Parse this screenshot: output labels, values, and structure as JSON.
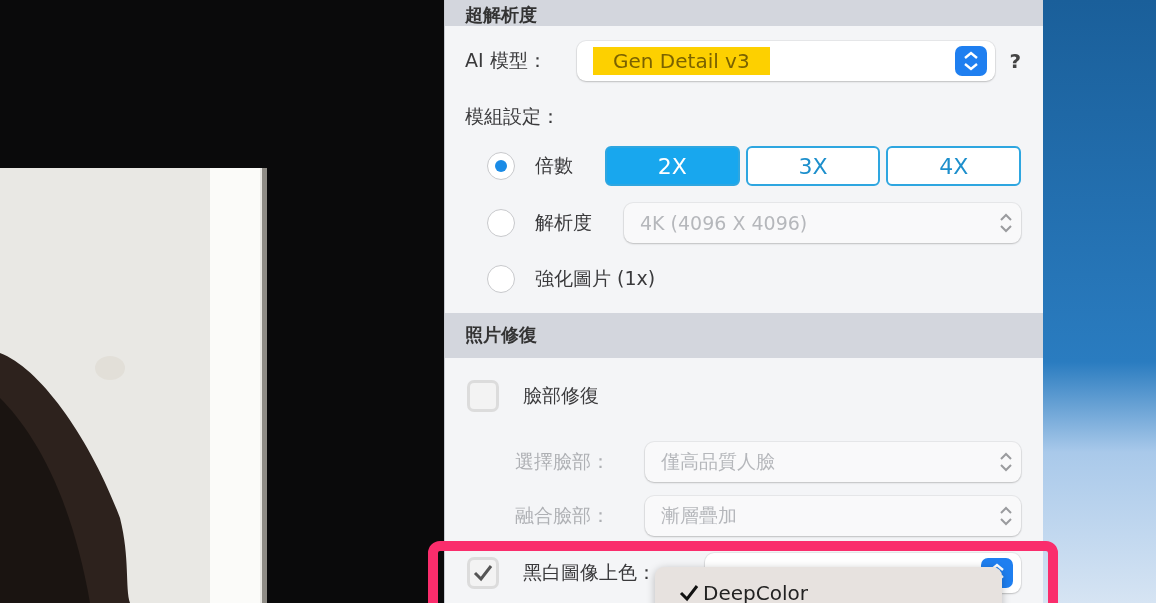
{
  "super_resolution": {
    "title": "超解析度",
    "ai_model": {
      "label": "AI 模型：",
      "value": "Gen Detail v3",
      "help": "?"
    },
    "module_label": "模組設定：",
    "options": [
      {
        "kind": "scale",
        "label": "倍數",
        "selected": true,
        "buttons": [
          {
            "label": "2X",
            "selected": true
          },
          {
            "label": "3X",
            "selected": false
          },
          {
            "label": "4X",
            "selected": false
          }
        ]
      },
      {
        "kind": "select",
        "label": "解析度",
        "selected": false,
        "value": "4K (4096 X 4096)",
        "disabled": true
      },
      {
        "kind": "plain",
        "label": "強化圖片 (1x)",
        "selected": false
      }
    ]
  },
  "photo_repair": {
    "title": "照片修復",
    "items": [
      {
        "kind": "checkbox",
        "label": "臉部修復",
        "checked": false
      },
      {
        "kind": "select",
        "label": "選擇臉部：",
        "value": "僅高品質人臉",
        "disabled": true
      },
      {
        "kind": "select",
        "label": "融合臉部：",
        "value": "漸層疊加",
        "disabled": true
      },
      {
        "kind": "checkbox_select",
        "label": "黑白圖像上色：",
        "checked": true
      }
    ]
  },
  "dropdown_menu": {
    "items": [
      {
        "label": "DeepColor",
        "selected": true
      }
    ]
  }
}
